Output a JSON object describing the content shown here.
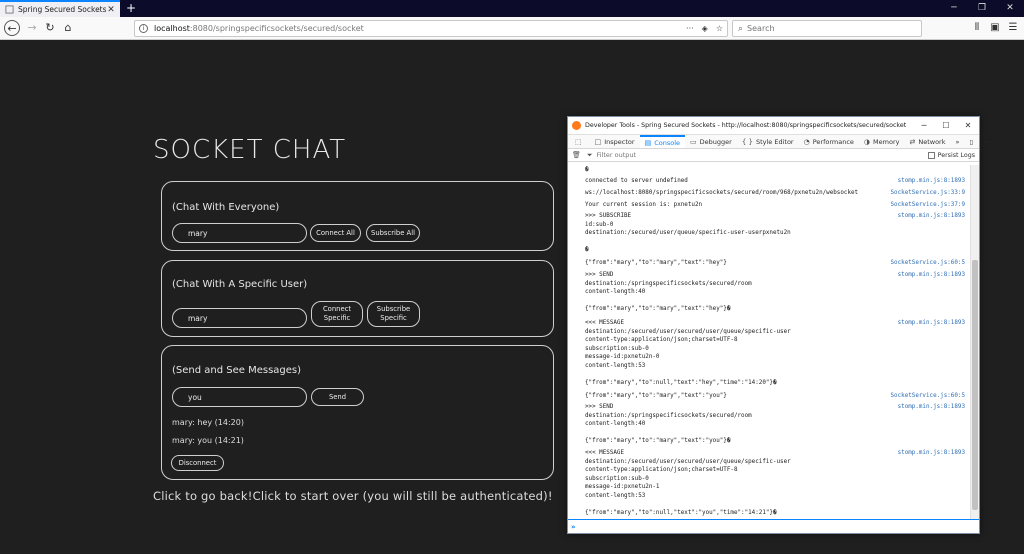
{
  "browser": {
    "tab_title": "Spring Secured Sockets",
    "url_host": "localhost",
    "url_path": ":8080/springspecificsockets/secured/socket",
    "url_actions": "···",
    "search_placeholder": "Search"
  },
  "page": {
    "title": "SOCKET CHAT",
    "everyone": {
      "heading": "(Chat With Everyone)",
      "input_value": "mary",
      "connect_label": "Connect All",
      "subscribe_label": "Subscribe All"
    },
    "specific": {
      "heading": "(Chat With A Specific User)",
      "input_value": "mary",
      "connect_line1": "Connect",
      "connect_line2": "Specific",
      "subscribe_line1": "Subscribe",
      "subscribe_line2": "Specific"
    },
    "send": {
      "heading": "(Send and See Messages)",
      "input_value": "you",
      "send_label": "Send",
      "messages": [
        "mary: hey (14:20)",
        "mary: you (14:21)"
      ],
      "disconnect_label": "Disconnect"
    },
    "back_link": "Click to go back!",
    "start_over_link": "Click to start over (you will still be authenticated)!"
  },
  "devtools": {
    "title": "Developer Tools - Spring Secured Sockets - http://localhost:8080/springspecificsockets/secured/socket",
    "tabs": [
      {
        "icon": "□",
        "label": "Inspector"
      },
      {
        "icon": "▤",
        "label": "Console"
      },
      {
        "icon": "▭",
        "label": "Debugger"
      },
      {
        "icon": "{ }",
        "label": "Style Editor"
      },
      {
        "icon": "◔",
        "label": "Performance"
      },
      {
        "icon": "◑",
        "label": "Memory"
      },
      {
        "icon": "⇄",
        "label": "Network"
      }
    ],
    "filter_placeholder": "Filter output",
    "persist_label": "Persist Logs",
    "log": [
      {
        "msg": "�",
        "src": ""
      },
      {
        "msg": "connected to server undefined",
        "src": "stomp.min.js:8:1893"
      },
      {
        "msg": "ws://localhost:8080/springspecificsockets/secured/room/968/pxnetu2n/websocket",
        "src": "SocketService.js:33:9"
      },
      {
        "msg": "Your current session is: pxnetu2n",
        "src": "SocketService.js:37:9"
      },
      {
        "msg": ">>> SUBSCRIBE\nid:sub-0\ndestination:/secured/user/queue/specific-user-userpxnetu2n\n\n�",
        "src": "stomp.min.js:8:1893"
      },
      {
        "msg": "{\"from\":\"mary\",\"to\":\"mary\",\"text\":\"hey\"}",
        "src": "SocketService.js:60:5"
      },
      {
        "msg": ">>> SEND\ndestination:/springspecificsockets/secured/room\ncontent-length:40\n\n{\"from\":\"mary\",\"to\":\"mary\",\"text\":\"hey\"}�",
        "src": "stomp.min.js:8:1893"
      },
      {
        "msg": "<<< MESSAGE\ndestination:/secured/user/secured/user/queue/specific-user\ncontent-type:application/json;charset=UTF-8\nsubscription:sub-0\nmessage-id:pxnetu2n-0\ncontent-length:53\n\n{\"from\":\"mary\",\"to\":null,\"text\":\"hey\",\"time\":\"14:20\"}�",
        "src": "stomp.min.js:8:1893"
      },
      {
        "msg": "{\"from\":\"mary\",\"to\":\"mary\",\"text\":\"you\"}",
        "src": "SocketService.js:60:5"
      },
      {
        "msg": ">>> SEND\ndestination:/springspecificsockets/secured/room\ncontent-length:40\n\n{\"from\":\"mary\",\"to\":\"mary\",\"text\":\"you\"}�",
        "src": "stomp.min.js:8:1893"
      },
      {
        "msg": "<<< MESSAGE\ndestination:/secured/user/secured/user/queue/specific-user\ncontent-type:application/json;charset=UTF-8\nsubscription:sub-0\nmessage-id:pxnetu2n-1\ncontent-length:53\n\n{\"from\":\"mary\",\"to\":null,\"text\":\"you\",\"time\":\"14:21\"}�",
        "src": "stomp.min.js:8:1893"
      }
    ]
  },
  "colors": {
    "page_bg": "#1f1f1f",
    "accent": "#0a84ff",
    "link_blue": "#2e6db4"
  }
}
